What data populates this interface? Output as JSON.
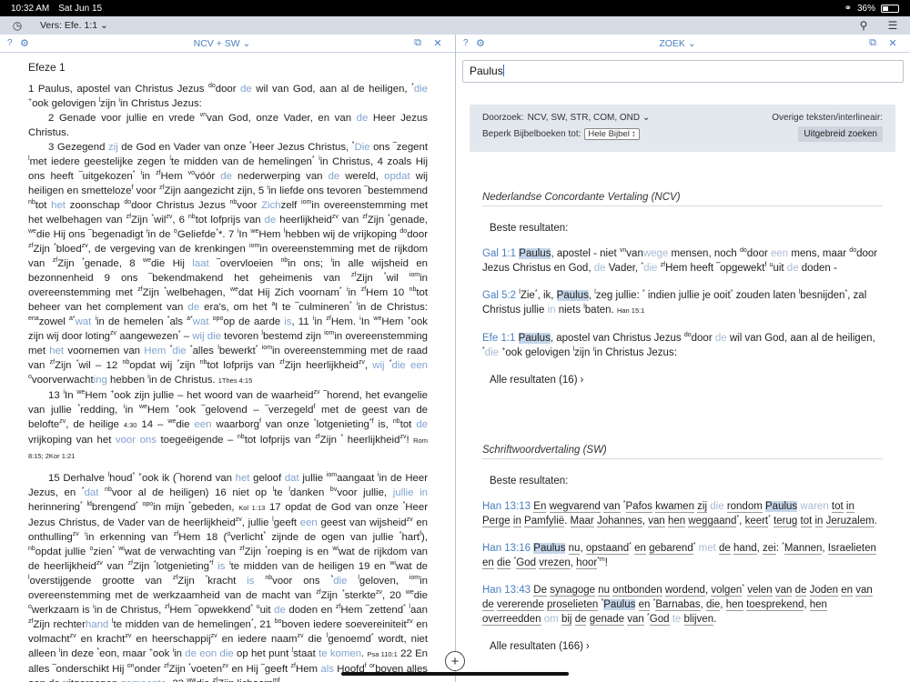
{
  "status": {
    "time": "10:32 AM",
    "date": "Sat Jun 15",
    "battery": "36%"
  },
  "appbar": {
    "vers_label": "Vers: Efe. 1:1"
  },
  "left_header": {
    "title": "NCV + SW"
  },
  "right_header": {
    "title": "ZOEK"
  },
  "search": {
    "value": "Paulus"
  },
  "filters": {
    "doorzoek_label": "Doorzoek:",
    "doorzoek_value": "NCV, SW, STR, COM, OND",
    "beperk_label": "Beperk Bijbelboeken tot:",
    "beperk_value": "Hele Bijbel",
    "overige_label": "Overige teksten/interlineair:",
    "advanced_button": "Uitgebreid zoeken"
  },
  "ncv": {
    "title": "Nederlandse Concordante Vertaling (NCV)",
    "best": "Beste resultaten:",
    "more": "Alle resultaten (16)"
  },
  "sw": {
    "title": "Schriftwoordvertaling (SW)",
    "best": "Beste resultaten:",
    "more": "Alle resultaten (166)"
  },
  "bible": {
    "chapter_title": "Efeze 1"
  },
  "icons": [
    "history-icon",
    "search-icon",
    "menu-icon",
    "help-icon",
    "gear-icon",
    "split-icon",
    "close-icon",
    "plus-icon"
  ]
}
